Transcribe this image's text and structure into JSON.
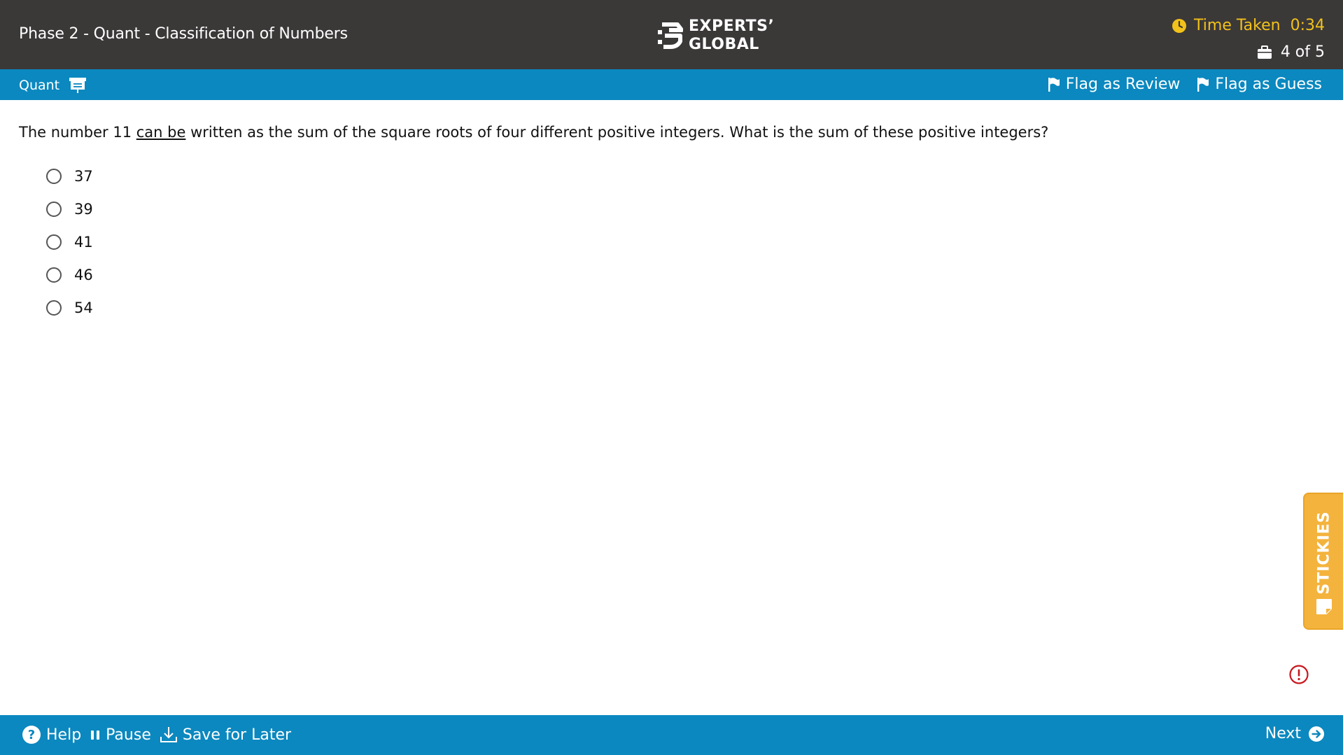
{
  "header": {
    "title": "Phase 2 - Quant - Classification of Numbers",
    "logo_line1": "EXPERTS’",
    "logo_line2": "GLOBAL",
    "timer_label": "Time Taken",
    "timer_value": "0:34",
    "progress": "4 of 5"
  },
  "subbar": {
    "section": "Quant",
    "flag_review": "Flag as Review",
    "flag_guess": "Flag as Guess"
  },
  "question": {
    "text_before": "The number 11 ",
    "underlined": "can be",
    "text_after": " written as the sum of the square roots of four different positive integers. What is the sum of these positive integers?",
    "options": [
      "37",
      "39",
      "41",
      "46",
      "54"
    ]
  },
  "stickies_label": "STICKIES",
  "footer": {
    "help": "Help",
    "pause": "Pause",
    "save_later": "Save for Later",
    "next": "Next"
  },
  "colors": {
    "header_bg": "#3b3838",
    "bar_blue": "#0b88bf",
    "timer_yellow": "#f2c21a",
    "stickies_orange": "#f4b33d",
    "alert_red": "#c8161d"
  },
  "icons": [
    "timer-icon",
    "briefcase-icon",
    "whiteboard-icon",
    "flag-icon",
    "sticky-note-icon",
    "alert-icon",
    "help-icon",
    "pause-icon",
    "download-icon",
    "next-arrow-icon"
  ]
}
